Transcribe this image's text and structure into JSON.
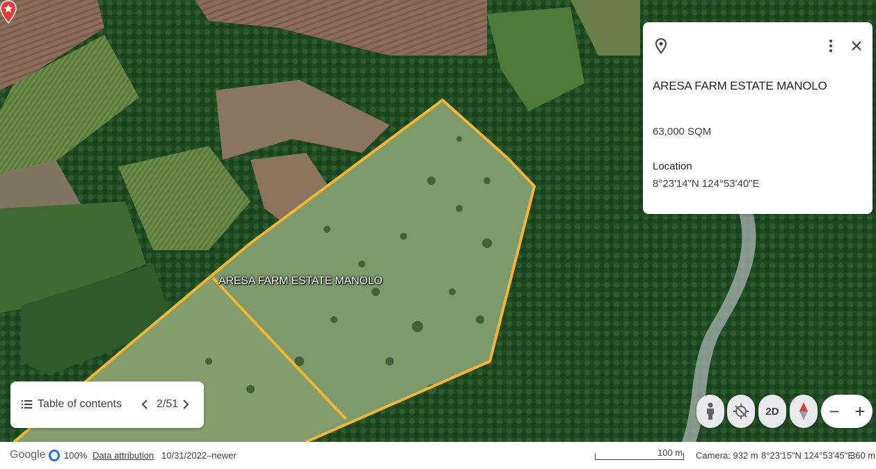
{
  "map": {
    "label": "ARESA FARM ESTATE MANOLO",
    "boundary_color": "#f2b630",
    "pin_color": "#e53935"
  },
  "info_panel": {
    "title": "ARESA FARM ESTATE MANOLO",
    "area": "63,000 SQM",
    "location_label": "Location",
    "location_value": "8°23'14\"N 124°53'40\"E",
    "icons": [
      "location-pin-icon",
      "more-vert-icon",
      "close-icon"
    ]
  },
  "toc": {
    "label": "Table of contents",
    "page": "2/51",
    "icons": [
      "list-icon",
      "chevron-left-icon",
      "chevron-right-icon"
    ]
  },
  "controls": {
    "view_mode": "2D",
    "zoom_out": "−",
    "zoom_in": "+",
    "icons": [
      "pegman-icon",
      "recenter-icon",
      "compass-icon"
    ]
  },
  "status_bar": {
    "logo": "Google",
    "load_percent": "100%",
    "data_attribution": "Data attribution",
    "imagery_date": "10/31/2022–newer",
    "scale": "100 m",
    "camera": "Camera: 932 m",
    "coordinates": "8°23'15\"N 124°53'45\"E",
    "elevation": "360 m"
  }
}
